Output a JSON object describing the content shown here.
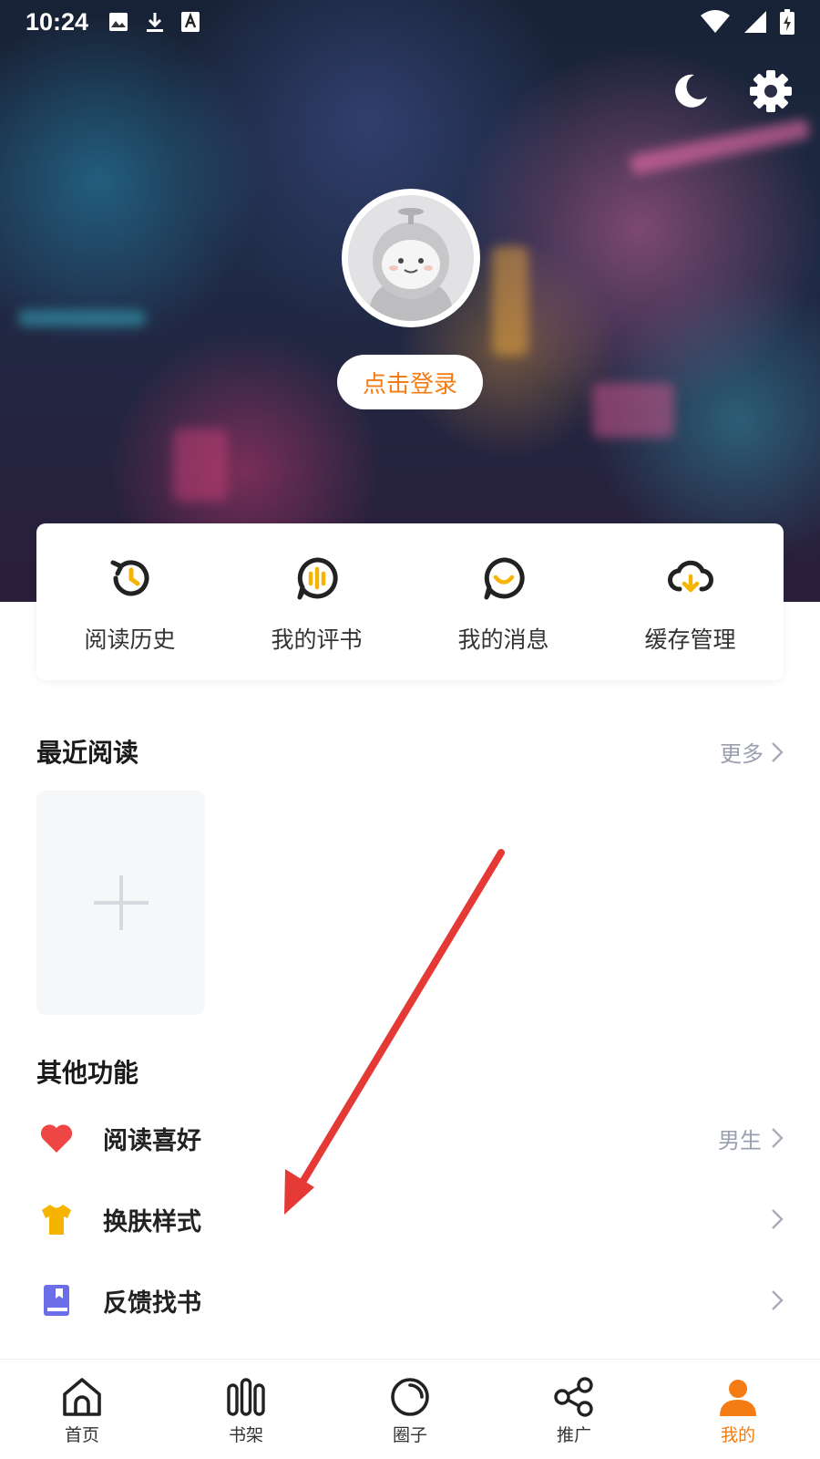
{
  "status_bar": {
    "time": "10:24"
  },
  "profile": {
    "login_label": "点击登录"
  },
  "quick_actions": [
    {
      "label": "阅读历史",
      "icon": "history-icon"
    },
    {
      "label": "我的评书",
      "icon": "audio-comment-icon"
    },
    {
      "label": "我的消息",
      "icon": "message-icon"
    },
    {
      "label": "缓存管理",
      "icon": "cloud-download-icon"
    }
  ],
  "recent": {
    "title": "最近阅读",
    "more_label": "更多"
  },
  "other": {
    "title": "其他功能",
    "items": [
      {
        "label": "阅读喜好",
        "value": "男生",
        "icon": "heart-icon",
        "color": "#ee4545"
      },
      {
        "label": "换肤样式",
        "value": "",
        "icon": "tshirt-icon",
        "color": "#f6b400"
      },
      {
        "label": "反馈找书",
        "value": "",
        "icon": "book-icon",
        "color": "#6b6ee8"
      }
    ]
  },
  "bottom_nav": [
    {
      "label": "首页",
      "icon": "home-icon"
    },
    {
      "label": "书架",
      "icon": "bookshelf-icon"
    },
    {
      "label": "圈子",
      "icon": "circle-icon"
    },
    {
      "label": "推广",
      "icon": "share-icon"
    },
    {
      "label": "我的",
      "icon": "profile-icon",
      "active": true
    }
  ],
  "colors": {
    "accent": "#f57c12",
    "annotation_arrow": "#e53935"
  }
}
